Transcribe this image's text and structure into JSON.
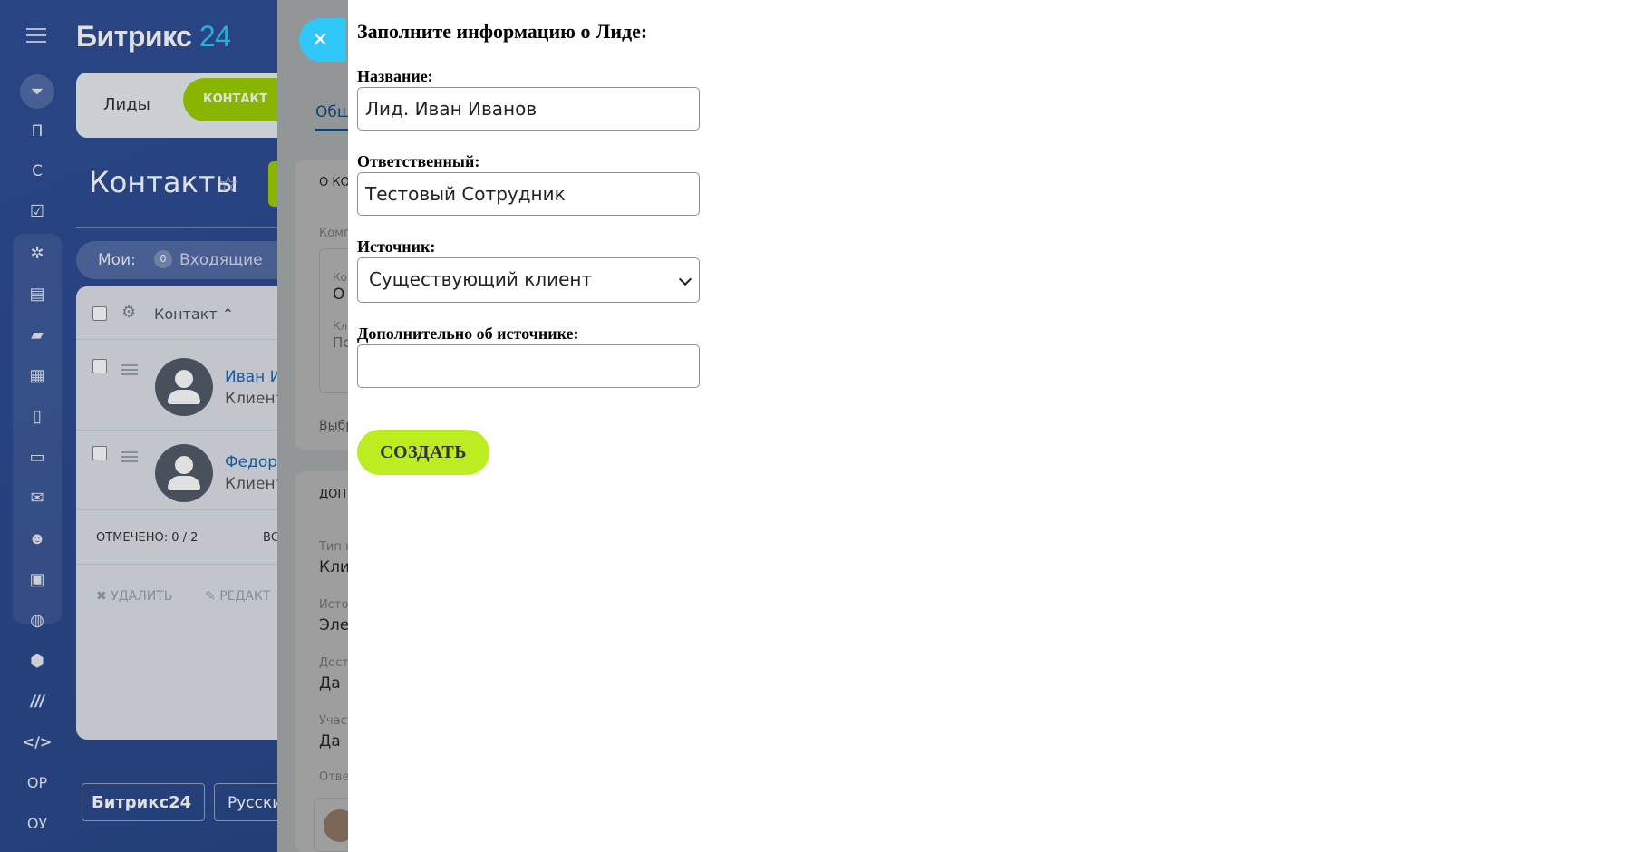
{
  "app": {
    "logo_text": "Битрикс",
    "logo_num": "24",
    "footer_logo": "Битрикс24",
    "footer_lang": "Русски"
  },
  "leftbar": {
    "letters": [
      "П",
      "С",
      "ОР",
      "ОУ"
    ]
  },
  "crm": {
    "tabs": {
      "leads": "Лиды",
      "contact": "КОНТАКТ"
    },
    "page_title": "Контакты",
    "filter": {
      "mine": "Мои:",
      "incoming_count": "0",
      "incoming": "Входящие"
    },
    "table": {
      "column": "Контакт",
      "rows": [
        {
          "name": "Иван И",
          "type": "Клиент"
        },
        {
          "name": "Федор",
          "type": "Клиент"
        }
      ],
      "marked": "ОТМЕЧЕНО: 0 / 2",
      "marked_extra": "ВС",
      "delete": "УДАЛИТЬ",
      "edit": "РЕДАКТ"
    }
  },
  "slider": {
    "tab_general": "Общ",
    "section_about": "О КО",
    "comp_label": "Комп",
    "k_label": "Ко",
    "k_value": "О",
    "kl_label": "Кл",
    "kl_value": "По",
    "choose": "Выбр",
    "section_extra": "ДОП",
    "fields": [
      {
        "label": "Тип к",
        "value": "Кли"
      },
      {
        "label": "Исто",
        "value": "Элек"
      },
      {
        "label": "Досту",
        "value": "Да"
      },
      {
        "label": "Участ",
        "value": "Да"
      },
      {
        "label": "Отве",
        "value": ""
      }
    ]
  },
  "form": {
    "heading": "Заполните информацию о Лиде:",
    "name_label": "Название:",
    "name_value": "Лид. Иван Иванов",
    "resp_label": "Ответственный:",
    "resp_value": "Тестовый Сотрудник",
    "source_label": "Источник:",
    "source_value": "Существующий клиент",
    "extra_label": "Дополнительно об источнике:",
    "extra_value": "",
    "submit": "СОЗДАТЬ"
  },
  "colors": {
    "accent_green": "#bbed21",
    "bitrix_green": "#9dcf00",
    "close_blue": "#2fc7f7",
    "link_blue": "#2067b0"
  }
}
